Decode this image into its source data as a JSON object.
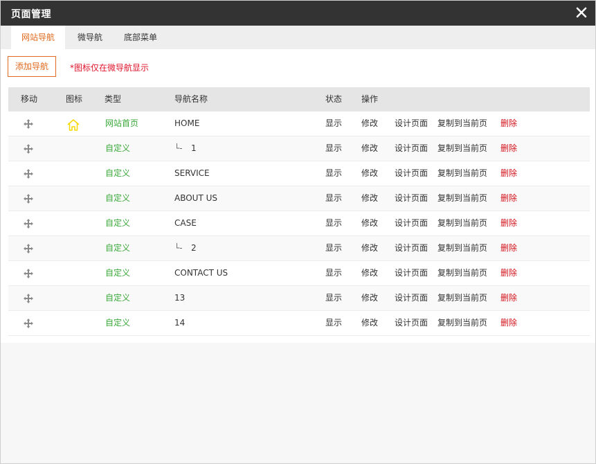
{
  "dialog": {
    "title": "页面管理"
  },
  "tabs": [
    {
      "label": "网站导航",
      "active": true
    },
    {
      "label": "微导航",
      "active": false
    },
    {
      "label": "底部菜单",
      "active": false
    }
  ],
  "toolbar": {
    "add_label": "添加导航",
    "hint": "*图标仅在微导航显示"
  },
  "table": {
    "headers": {
      "move": "移动",
      "icon": "图标",
      "type": "类型",
      "name": "导航名称",
      "status": "状态",
      "actions": "操作"
    },
    "rows": [
      {
        "type": "网站首页",
        "prefix": "",
        "name": "HOME",
        "status": "显示",
        "icon": "home-icon"
      },
      {
        "type": "自定义",
        "prefix": "└-",
        "name": "1",
        "status": "显示",
        "icon": ""
      },
      {
        "type": "自定义",
        "prefix": "",
        "name": "SERVICE",
        "status": "显示",
        "icon": ""
      },
      {
        "type": "自定义",
        "prefix": "",
        "name": "ABOUT US",
        "status": "显示",
        "icon": ""
      },
      {
        "type": "自定义",
        "prefix": "",
        "name": "CASE",
        "status": "显示",
        "icon": ""
      },
      {
        "type": "自定义",
        "prefix": "└-",
        "name": "2",
        "status": "显示",
        "icon": ""
      },
      {
        "type": "自定义",
        "prefix": "",
        "name": "CONTACT US",
        "status": "显示",
        "icon": ""
      },
      {
        "type": "自定义",
        "prefix": "",
        "name": "13",
        "status": "显示",
        "icon": ""
      },
      {
        "type": "自定义",
        "prefix": "",
        "name": "14",
        "status": "显示",
        "icon": ""
      }
    ],
    "row_actions": {
      "edit": "修改",
      "design": "设计页面",
      "copy": "复制到当前页",
      "delete": "删除"
    }
  },
  "colors": {
    "accent": "#e0691d",
    "type_green": "#3aa83a",
    "delete_red": "#d4141c",
    "hint_red": "#e0142b",
    "titlebar": "#333333",
    "home_icon": "#f5d800"
  }
}
